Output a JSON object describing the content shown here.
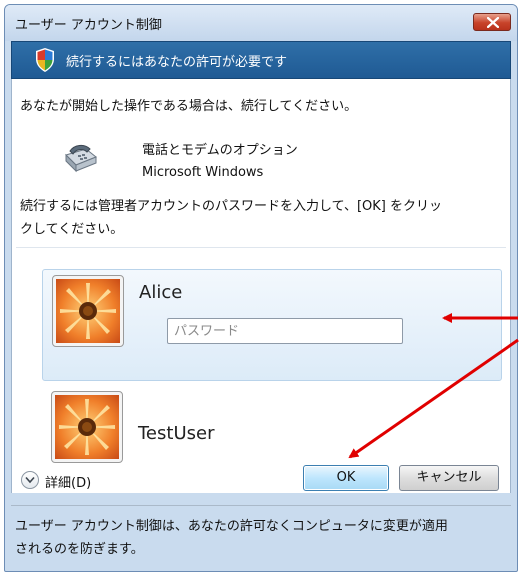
{
  "window": {
    "title": "ユーザー アカウント制御"
  },
  "banner": {
    "text": "続行するにはあなたの許可が必要です"
  },
  "content": {
    "intro": "あなたが開始した操作である場合は、続行してください。",
    "program": {
      "name": "電話とモデムのオプション",
      "publisher": "Microsoft Windows"
    },
    "instruction_line1": "続行するには管理者アカウントのパスワードを入力して、[OK] をクリッ",
    "instruction_line2": "クしてください。"
  },
  "users": [
    {
      "name": "Alice",
      "selected": true,
      "password_placeholder": "パスワード"
    },
    {
      "name": "TestUser",
      "selected": false
    }
  ],
  "footer": {
    "details_label": "詳細(D)",
    "ok_label": "OK",
    "cancel_label": "キャンセル",
    "note_line1": "ユーザー アカウント制御は、あなたの許可なくコンピュータに変更が適用",
    "note_line2": "されるのを防ぎます。"
  },
  "colors": {
    "banner": "#1f5a94",
    "annotation_arrow": "#e00000",
    "close_button": "#c8432a"
  }
}
